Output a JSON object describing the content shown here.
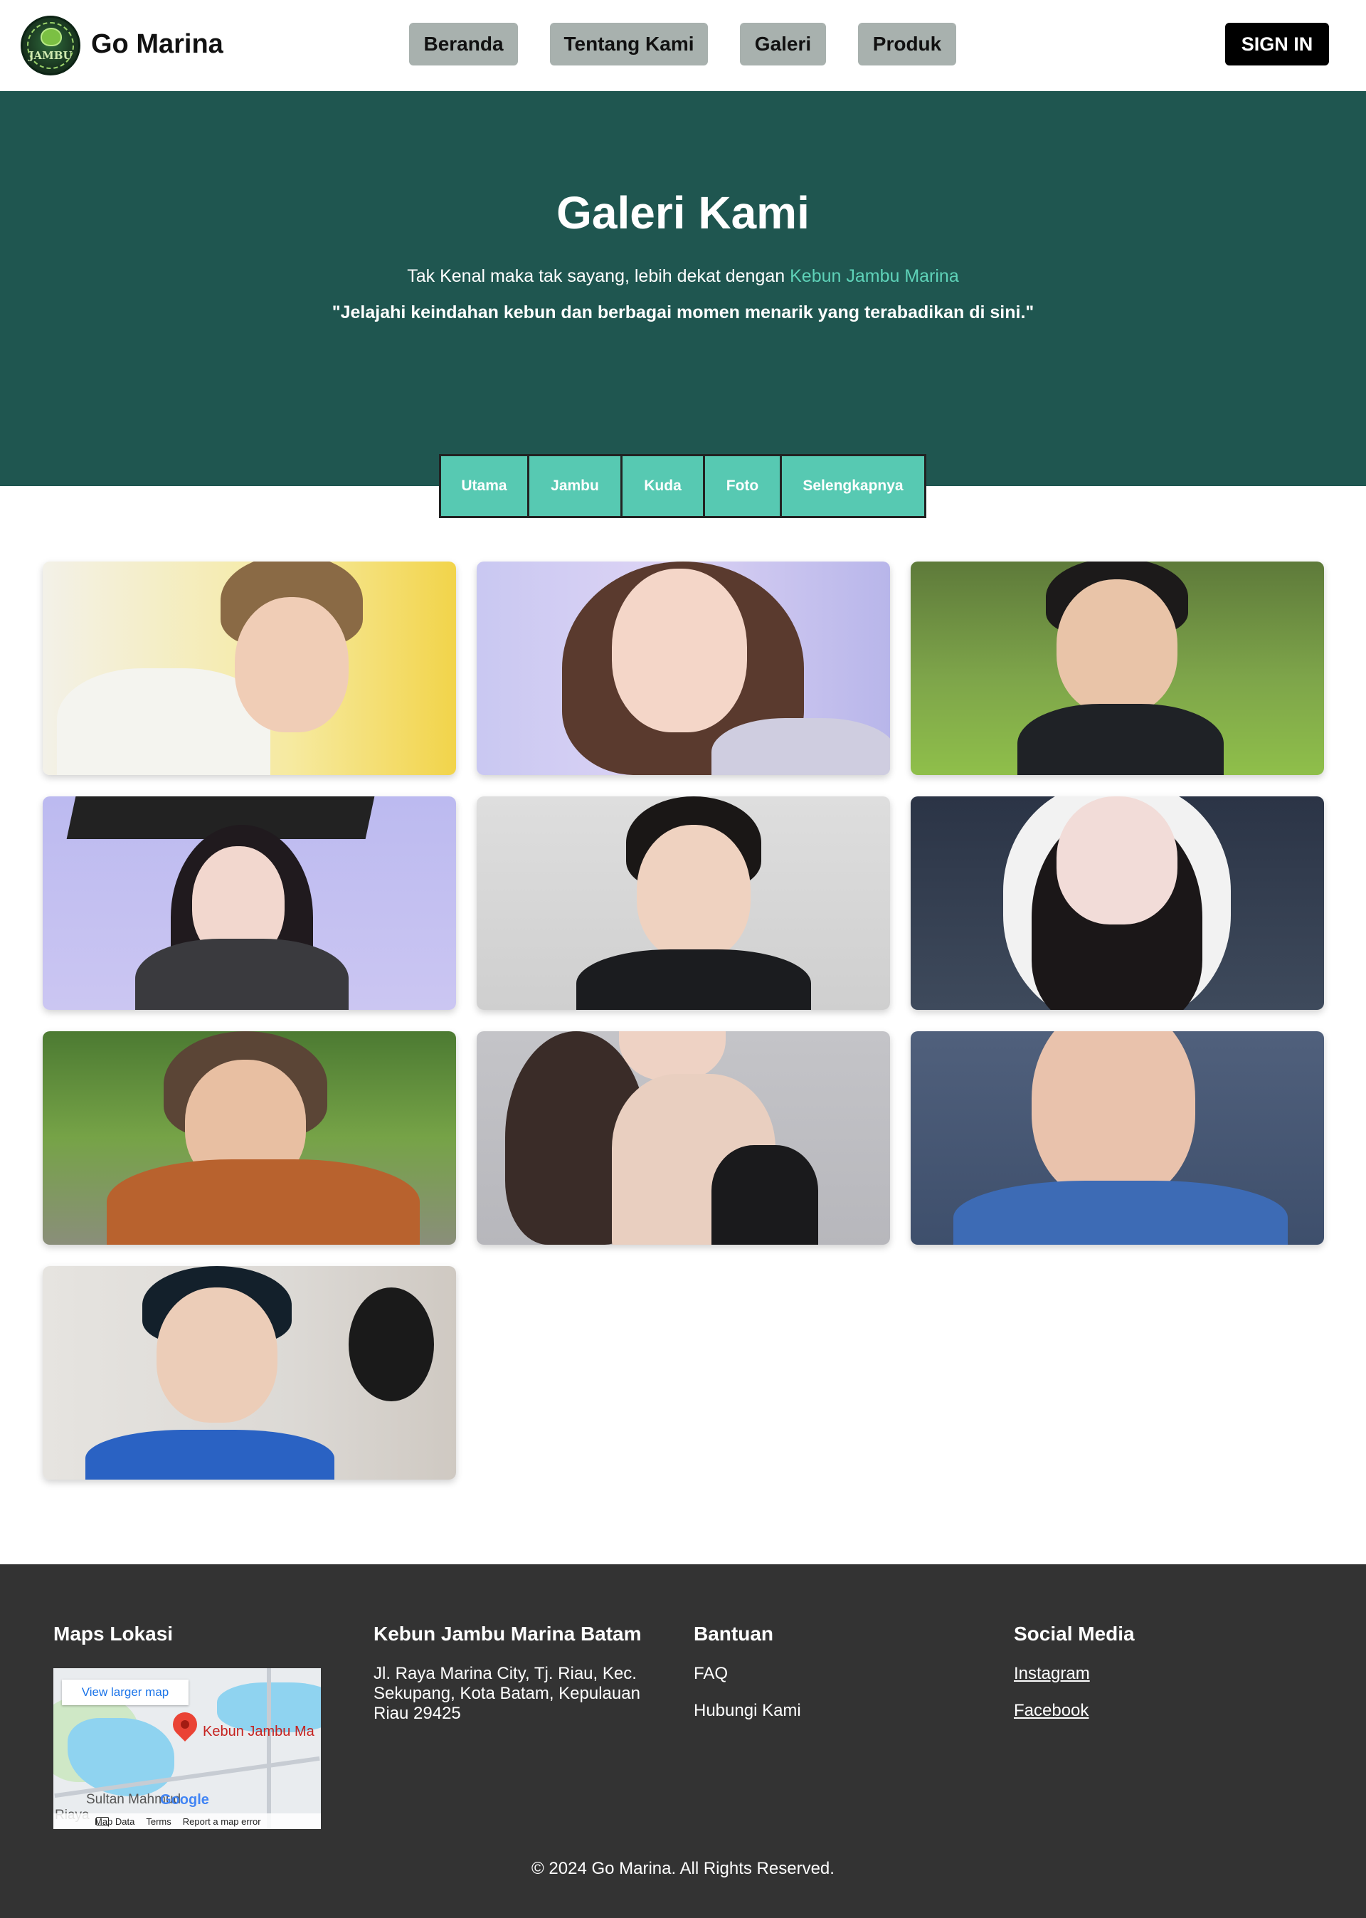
{
  "header": {
    "brand": "Go Marina",
    "logo_text": "JAMBU",
    "nav": [
      {
        "label": "Beranda"
      },
      {
        "label": "Tentang Kami"
      },
      {
        "label": "Galeri"
      },
      {
        "label": "Produk"
      }
    ],
    "signin_label": "SIGN IN"
  },
  "hero": {
    "title": "Galeri Kami",
    "subtitle_prefix": "Tak Kenal maka tak sayang, lebih dekat dengan ",
    "subtitle_highlight": "Kebun Jambu Marina",
    "quote": "\"Jelajahi keindahan kebun dan berbagai momen menarik yang terabadikan di sini.\""
  },
  "tabs": [
    {
      "label": "Utama"
    },
    {
      "label": "Jambu"
    },
    {
      "label": "Kuda"
    },
    {
      "label": "Foto"
    },
    {
      "label": "Selengkapnya"
    }
  ],
  "footer": {
    "maps": {
      "heading": "Maps Lokasi",
      "view_larger": "View larger map",
      "place_label": "Kebun Jambu Ma",
      "area_label": "Sultan Mahmud",
      "area_label_2": "Riaya",
      "google": "Google",
      "map_data": "Map Data",
      "terms": "Terms",
      "report": "Report a map error"
    },
    "address": {
      "heading": "Kebun Jambu Marina Batam",
      "line1": "Jl. Raya Marina City, Tj. Riau, Kec.",
      "line2": "Sekupang, Kota Batam, Kepulauan",
      "line3": "Riau 29425"
    },
    "help": {
      "heading": "Bantuan",
      "items": [
        {
          "label": "FAQ"
        },
        {
          "label": "Hubungi Kami"
        }
      ]
    },
    "social": {
      "heading": "Social Media",
      "items": [
        {
          "label": "Instagram"
        },
        {
          "label": "Facebook"
        }
      ]
    },
    "copyright": "© 2024 Go Marina. All Rights Reserved."
  },
  "colors": {
    "hero_bg": "#1f5650",
    "accent": "#57c9b2",
    "nav_bg": "#a8b1ae",
    "footer_bg": "#333333"
  }
}
